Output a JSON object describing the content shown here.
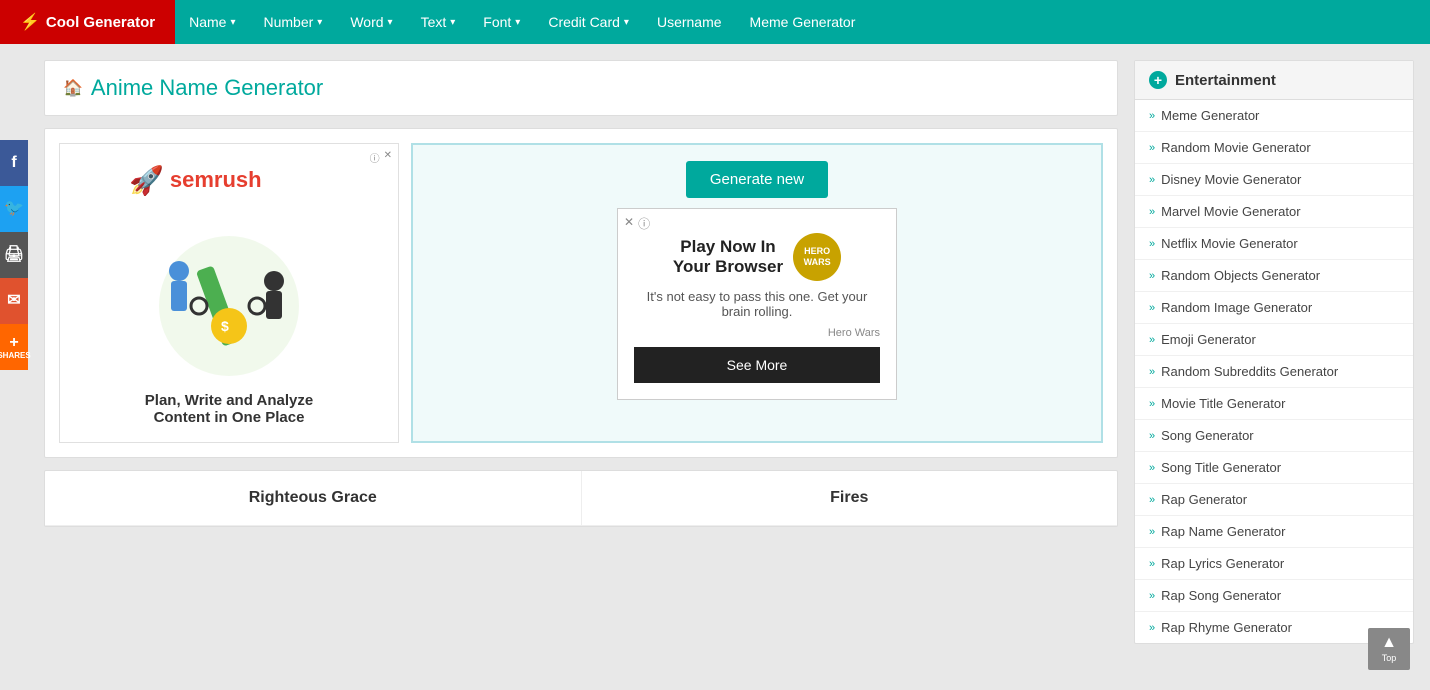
{
  "brand": {
    "label": "Cool Generator",
    "icon": "⚡"
  },
  "nav": {
    "items": [
      {
        "label": "Name",
        "hasDropdown": true
      },
      {
        "label": "Number",
        "hasDropdown": true
      },
      {
        "label": "Word",
        "hasDropdown": true
      },
      {
        "label": "Text",
        "hasDropdown": true
      },
      {
        "label": "Font",
        "hasDropdown": true
      },
      {
        "label": "Credit Card",
        "hasDropdown": true
      },
      {
        "label": "Username",
        "hasDropdown": false
      },
      {
        "label": "Meme Generator",
        "hasDropdown": false
      }
    ]
  },
  "social": [
    {
      "name": "facebook",
      "icon": "f",
      "class": "fb"
    },
    {
      "name": "twitter",
      "icon": "🐦",
      "class": "tw"
    },
    {
      "name": "print",
      "icon": "🖨",
      "class": "pr"
    },
    {
      "name": "email",
      "icon": "✉",
      "class": "em"
    },
    {
      "name": "shares",
      "label": "SHARES",
      "class": "sh"
    }
  ],
  "page": {
    "title": "Anime Name Generator",
    "home_icon": "🏠"
  },
  "ad_left": {
    "info_icon": "ⓘ",
    "close_icon": "✕",
    "logo": "semrush",
    "caption": "Plan, Write and Analyze\nContent in One Place"
  },
  "generate_button": "Generate new",
  "inner_ad": {
    "close_icon": "✕",
    "info_icon": "ⓘ",
    "header_line1": "Play Now In",
    "header_line2": "Your Browser",
    "badge_text": "HERO WARS",
    "body": "It's not easy to pass this one. Get your brain rolling.",
    "attribution": "Hero Wars",
    "cta": "See More"
  },
  "results": {
    "cells": [
      "Righteous Grace",
      "Fires"
    ]
  },
  "sidebar": {
    "header": "Entertainment",
    "plus_icon": "+",
    "items": [
      "Meme Generator",
      "Random Movie Generator",
      "Disney Movie Generator",
      "Marvel Movie Generator",
      "Netflix Movie Generator",
      "Random Objects Generator",
      "Random Image Generator",
      "Emoji Generator",
      "Random Subreddits Generator",
      "Movie Title Generator",
      "Song Generator",
      "Song Title Generator",
      "Rap Generator",
      "Rap Name Generator",
      "Rap Lyrics Generator",
      "Rap Song Generator",
      "Rap Rhyme Generator"
    ]
  },
  "back_to_top": {
    "arrow": "▲",
    "label": "Top"
  }
}
